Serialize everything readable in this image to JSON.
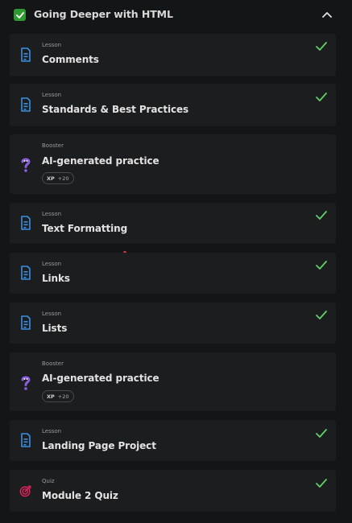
{
  "section": {
    "title": "Going Deeper with HTML",
    "completed": true,
    "expanded": true
  },
  "items": [
    {
      "type": "Lesson",
      "title": "Comments",
      "icon": "lesson-icon",
      "completed": true
    },
    {
      "type": "Lesson",
      "title": "Standards & Best Practices",
      "icon": "lesson-icon",
      "completed": true
    },
    {
      "type": "Booster",
      "title": "AI-generated practice",
      "icon": "ai-booster-icon",
      "completed": false,
      "xp_label": "XP",
      "xp_value": "+20"
    },
    {
      "type": "Lesson",
      "title": "Text Formatting",
      "icon": "lesson-icon",
      "completed": true
    },
    {
      "type": "Lesson",
      "title": "Links",
      "icon": "lesson-icon",
      "completed": true
    },
    {
      "type": "Lesson",
      "title": "Lists",
      "icon": "lesson-icon",
      "completed": true
    },
    {
      "type": "Booster",
      "title": "AI-generated practice",
      "icon": "ai-booster-icon",
      "completed": false,
      "xp_label": "XP",
      "xp_value": "+20"
    },
    {
      "type": "Lesson",
      "title": "Landing Page Project",
      "icon": "lesson-icon",
      "completed": true
    },
    {
      "type": "Quiz",
      "title": "Module 2 Quiz",
      "icon": "quiz-target-icon",
      "completed": true
    }
  ],
  "colors": {
    "background": "#141516",
    "card": "#1c1d1f",
    "check_green": "#5fd06a",
    "lesson_blue": "#3b8fe0",
    "booster_purple": "#8b5ce0",
    "quiz_red": "#e0245e"
  }
}
